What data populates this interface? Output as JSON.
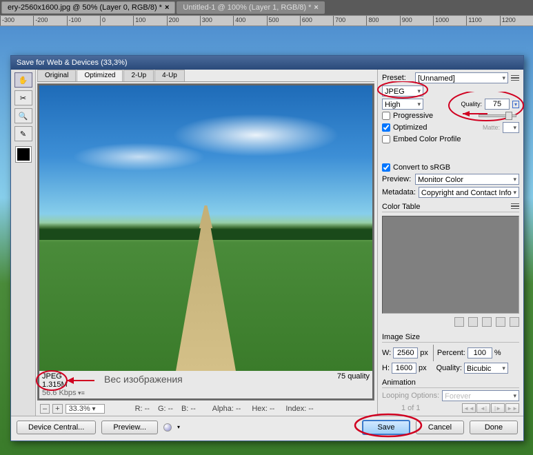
{
  "doc_tabs": [
    {
      "label": "ery-2560x1600.jpg @ 50% (Layer 0, RGB/8) *",
      "active": true
    },
    {
      "label": "Untitled-1 @ 100% (Layer 1, RGB/8) *",
      "active": false
    }
  ],
  "ruler": [
    "-300",
    "-200",
    "-100",
    "0",
    "100",
    "200",
    "300",
    "400",
    "500",
    "600",
    "700",
    "800",
    "900",
    "1000",
    "1100",
    "1200"
  ],
  "dialog": {
    "title": "Save for Web & Devices (33,3%)",
    "preview_tabs": [
      "Original",
      "Optimized",
      "2-Up",
      "4-Up"
    ],
    "preview_tab_active": "Optimized",
    "info": {
      "format": "JPEG",
      "size": "1.315M",
      "speed": "56.6 Kbps",
      "quality_text": "75 quality"
    },
    "zoom": {
      "value": "33.3%",
      "r": "R: --",
      "g": "G: --",
      "b": "B: --",
      "alpha": "Alpha: --",
      "hex": "Hex: --",
      "index": "Index: --"
    },
    "settings": {
      "preset_label": "Preset:",
      "preset": "[Unnamed]",
      "format": "JPEG",
      "quality_mode": "High",
      "quality_label": "Quality:",
      "quality_value": "75",
      "progressive": "Progressive",
      "progressive_checked": false,
      "optimized": "Optimized",
      "optimized_checked": true,
      "embed": "Embed Color Profile",
      "embed_checked": false,
      "matte_label": "Matte:",
      "convert": "Convert to sRGB",
      "convert_checked": true,
      "preview_label": "Preview:",
      "preview_value": "Monitor Color",
      "metadata_label": "Metadata:",
      "metadata_value": "Copyright and Contact Info",
      "color_table": "Color Table",
      "image_size": "Image Size",
      "w_label": "W:",
      "w_val": "2560",
      "px": "px",
      "h_label": "H:",
      "h_val": "1600",
      "percent_label": "Percent:",
      "percent_val": "100",
      "pct_sign": "%",
      "quality2_label": "Quality:",
      "quality2_val": "Bicubic",
      "animation": "Animation",
      "looping_label": "Looping Options:",
      "looping_val": "Forever",
      "frame": "1 of 1"
    },
    "footer": {
      "device_central": "Device Central...",
      "preview": "Preview...",
      "save": "Save",
      "cancel": "Cancel",
      "done": "Done"
    },
    "annotation": "Вес изображения"
  }
}
